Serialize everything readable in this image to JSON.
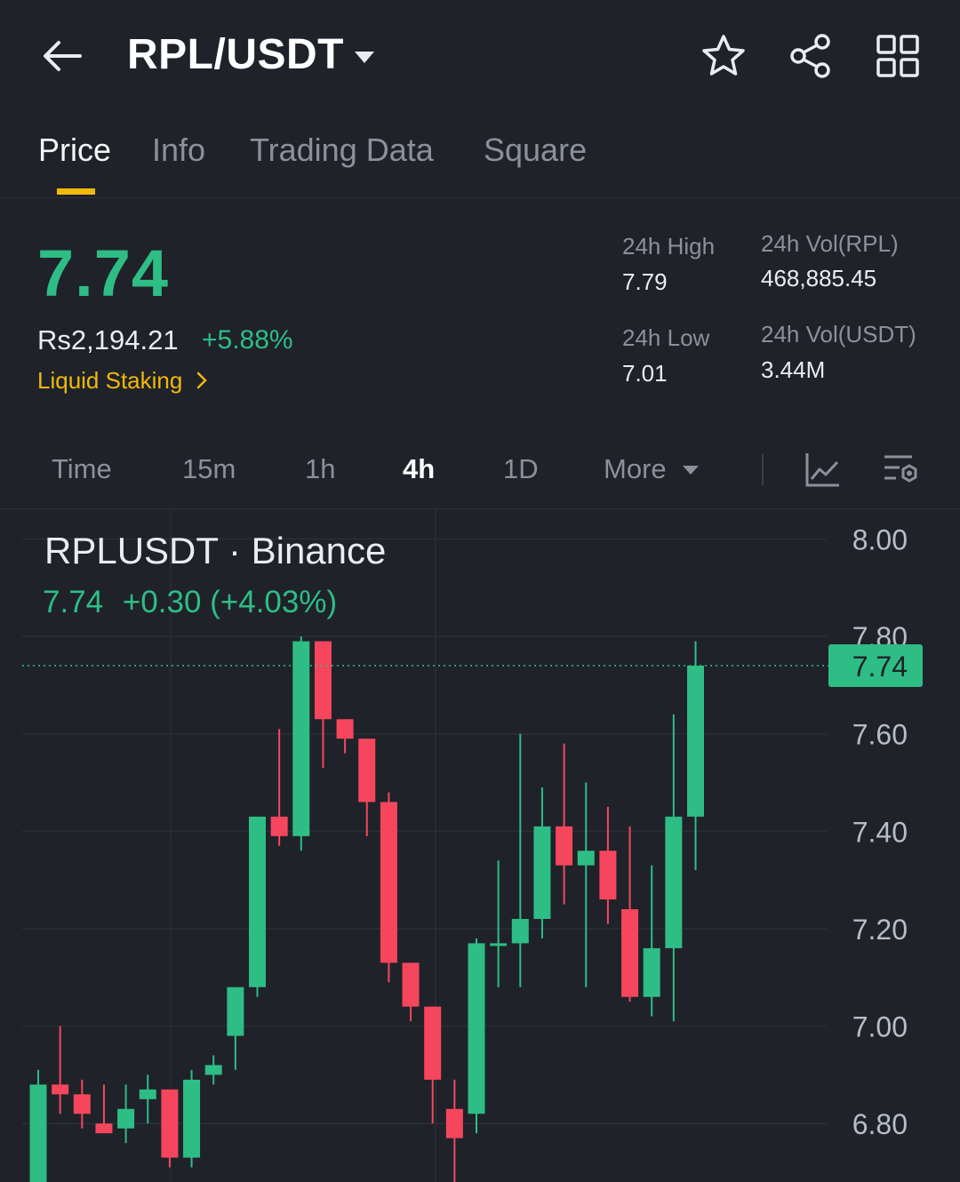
{
  "header": {
    "pair": "RPL/USDT",
    "icons": [
      "back-arrow-icon",
      "caret-down-icon",
      "star-icon",
      "share-icon",
      "grid-icon"
    ]
  },
  "tabs": [
    {
      "label": "Price",
      "active": true
    },
    {
      "label": "Info",
      "active": false
    },
    {
      "label": "Trading Data",
      "active": false
    },
    {
      "label": "Square",
      "active": false
    }
  ],
  "ticker": {
    "last_price": "7.74",
    "fiat_price": "Rs2,194.21",
    "change_pct": "+5.88%",
    "staking_link": "Liquid Staking",
    "high_label": "24h High",
    "high_value": "7.79",
    "low_label": "24h Low",
    "low_value": "7.01",
    "vol_base_label": "24h Vol(RPL)",
    "vol_base_value": "468,885.45",
    "vol_quote_label": "24h Vol(USDT)",
    "vol_quote_value": "3.44M"
  },
  "intervals": [
    {
      "label": "Time",
      "active": false
    },
    {
      "label": "15m",
      "active": false
    },
    {
      "label": "1h",
      "active": false
    },
    {
      "label": "4h",
      "active": true
    },
    {
      "label": "1D",
      "active": false
    },
    {
      "label": "More",
      "active": false
    }
  ],
  "colors": {
    "up": "#2ebd85",
    "down": "#f6465d",
    "accent": "#f0b90b",
    "background": "#1f2229"
  },
  "chart_data": {
    "type": "candlestick",
    "title": "RPLUSDT · Binance",
    "legend_price": "7.74",
    "legend_change": "+0.30 (+4.03%)",
    "y_ticks": [
      "8.00",
      "7.80",
      "7.60",
      "7.40",
      "7.20",
      "7.00",
      "6.80"
    ],
    "ylim": [
      6.68,
      8.03
    ],
    "current_price_label": "7.74",
    "current_price": 7.74,
    "grid": true,
    "candles": [
      {
        "open": 6.64,
        "high": 6.91,
        "low": 6.62,
        "close": 6.88
      },
      {
        "open": 6.88,
        "high": 7.0,
        "low": 6.82,
        "close": 6.86
      },
      {
        "open": 6.86,
        "high": 6.89,
        "low": 6.79,
        "close": 6.82
      },
      {
        "open": 6.8,
        "high": 6.88,
        "low": 6.78,
        "close": 6.78
      },
      {
        "open": 6.79,
        "high": 6.88,
        "low": 6.76,
        "close": 6.83
      },
      {
        "open": 6.85,
        "high": 6.9,
        "low": 6.8,
        "close": 6.87
      },
      {
        "open": 6.87,
        "high": 6.87,
        "low": 6.71,
        "close": 6.73
      },
      {
        "open": 6.73,
        "high": 6.91,
        "low": 6.71,
        "close": 6.89
      },
      {
        "open": 6.9,
        "high": 6.94,
        "low": 6.88,
        "close": 6.92
      },
      {
        "open": 6.98,
        "high": 7.06,
        "low": 6.91,
        "close": 7.08
      },
      {
        "open": 7.08,
        "high": 7.42,
        "low": 7.06,
        "close": 7.43
      },
      {
        "open": 7.43,
        "high": 7.61,
        "low": 7.37,
        "close": 7.39
      },
      {
        "open": 7.39,
        "high": 7.8,
        "low": 7.36,
        "close": 7.79
      },
      {
        "open": 7.79,
        "high": 7.78,
        "low": 7.53,
        "close": 7.63
      },
      {
        "open": 7.63,
        "high": 7.63,
        "low": 7.56,
        "close": 7.59
      },
      {
        "open": 7.59,
        "high": 7.59,
        "low": 7.39,
        "close": 7.46
      },
      {
        "open": 7.46,
        "high": 7.48,
        "low": 7.09,
        "close": 7.13
      },
      {
        "open": 7.13,
        "high": 7.13,
        "low": 7.01,
        "close": 7.04
      },
      {
        "open": 7.04,
        "high": 7.04,
        "low": 6.8,
        "close": 6.89
      },
      {
        "open": 6.83,
        "high": 6.89,
        "low": 6.68,
        "close": 6.77
      },
      {
        "open": 6.82,
        "high": 7.18,
        "low": 6.78,
        "close": 7.17
      },
      {
        "open": 7.17,
        "high": 7.34,
        "low": 7.08,
        "close": 7.17
      },
      {
        "open": 7.17,
        "high": 7.6,
        "low": 7.08,
        "close": 7.22
      },
      {
        "open": 7.22,
        "high": 7.49,
        "low": 7.18,
        "close": 7.41
      },
      {
        "open": 7.41,
        "high": 7.58,
        "low": 7.25,
        "close": 7.33
      },
      {
        "open": 7.33,
        "high": 7.5,
        "low": 7.08,
        "close": 7.36
      },
      {
        "open": 7.36,
        "high": 7.45,
        "low": 7.21,
        "close": 7.26
      },
      {
        "open": 7.24,
        "high": 7.41,
        "low": 7.05,
        "close": 7.06
      },
      {
        "open": 7.06,
        "high": 7.33,
        "low": 7.02,
        "close": 7.16
      },
      {
        "open": 7.16,
        "high": 7.64,
        "low": 7.01,
        "close": 7.43
      },
      {
        "open": 7.43,
        "high": 7.79,
        "low": 7.32,
        "close": 7.74
      }
    ]
  }
}
